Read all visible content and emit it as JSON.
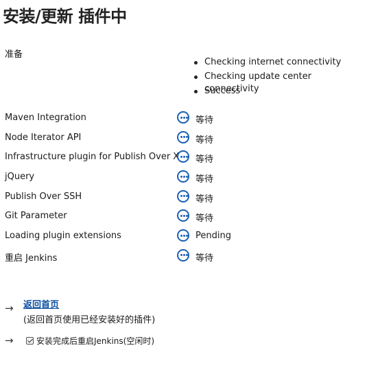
{
  "title": "安装/更新 插件中",
  "preparation": {
    "label": "准备",
    "checks": [
      "Checking internet connectivity",
      "Checking update center connectivity",
      "Success"
    ]
  },
  "plugins": [
    {
      "name": "Maven Integration",
      "status": "等待",
      "icon": "pending-dots-icon"
    },
    {
      "name": "Node Iterator API",
      "status": "等待",
      "icon": "pending-dots-icon"
    },
    {
      "name": "Infrastructure plugin for Publish Over X",
      "status": "等待",
      "icon": "pending-dots-icon"
    },
    {
      "name": "jQuery",
      "status": "等待",
      "icon": "pending-dots-icon"
    },
    {
      "name": "Publish Over SSH",
      "status": "等待",
      "icon": "pending-dots-icon"
    },
    {
      "name": "Git Parameter",
      "status": "等待",
      "icon": "pending-dots-icon"
    },
    {
      "name": "Loading plugin extensions",
      "status": "Pending",
      "icon": "pending-dots-icon"
    },
    {
      "name": "重启 Jenkins",
      "status": "等待",
      "icon": "pending-dots-icon"
    }
  ],
  "actions": {
    "home_link": "返回首页",
    "home_sub": "(返回首页使用已经安装好的插件)",
    "restart_label": "安装完成后重启Jenkins(空闲时)",
    "restart_checked": true,
    "arrow_icon": "arrow-right-icon"
  }
}
